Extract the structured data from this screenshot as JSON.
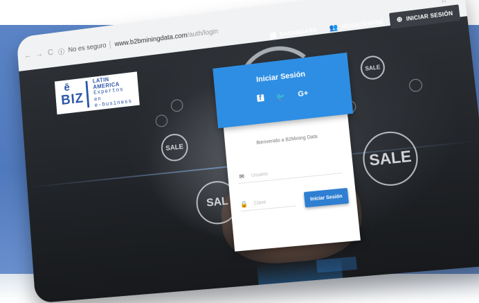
{
  "browser": {
    "security_label": "No es seguro",
    "url_host": "www.b2bminingdata.com",
    "url_path": "/auth/login"
  },
  "topnav": {
    "items": [
      {
        "label": "DASHBOARD",
        "icon": "dashboard-grid-icon"
      },
      {
        "label": "REGISTRARSE",
        "icon": "add-user-icon"
      },
      {
        "label": "INICIAR SESIÓN",
        "icon": "login-icon"
      }
    ]
  },
  "logo": {
    "mark_e": "ē",
    "mark_biz": "BIZ",
    "line1": "LATIN AMERICA",
    "line2": "Expertos en",
    "line3": "e-business"
  },
  "background": {
    "bubbles": [
      "SALE",
      "SAL",
      "SALE",
      "SALE"
    ]
  },
  "login_card": {
    "title": "Iniciar Sesión",
    "social": [
      "f",
      "G+"
    ],
    "welcome": "Bienvenido a B2Mining Data",
    "username_placeholder": "Usuario",
    "password_placeholder": "Clave",
    "submit_label": "Iniciar Sesión"
  },
  "colors": {
    "header_blue": "#2e8ee3",
    "button_blue": "#2e7fd1",
    "brand_blue": "#2b55a6",
    "background_blue": "#5a84c6"
  }
}
